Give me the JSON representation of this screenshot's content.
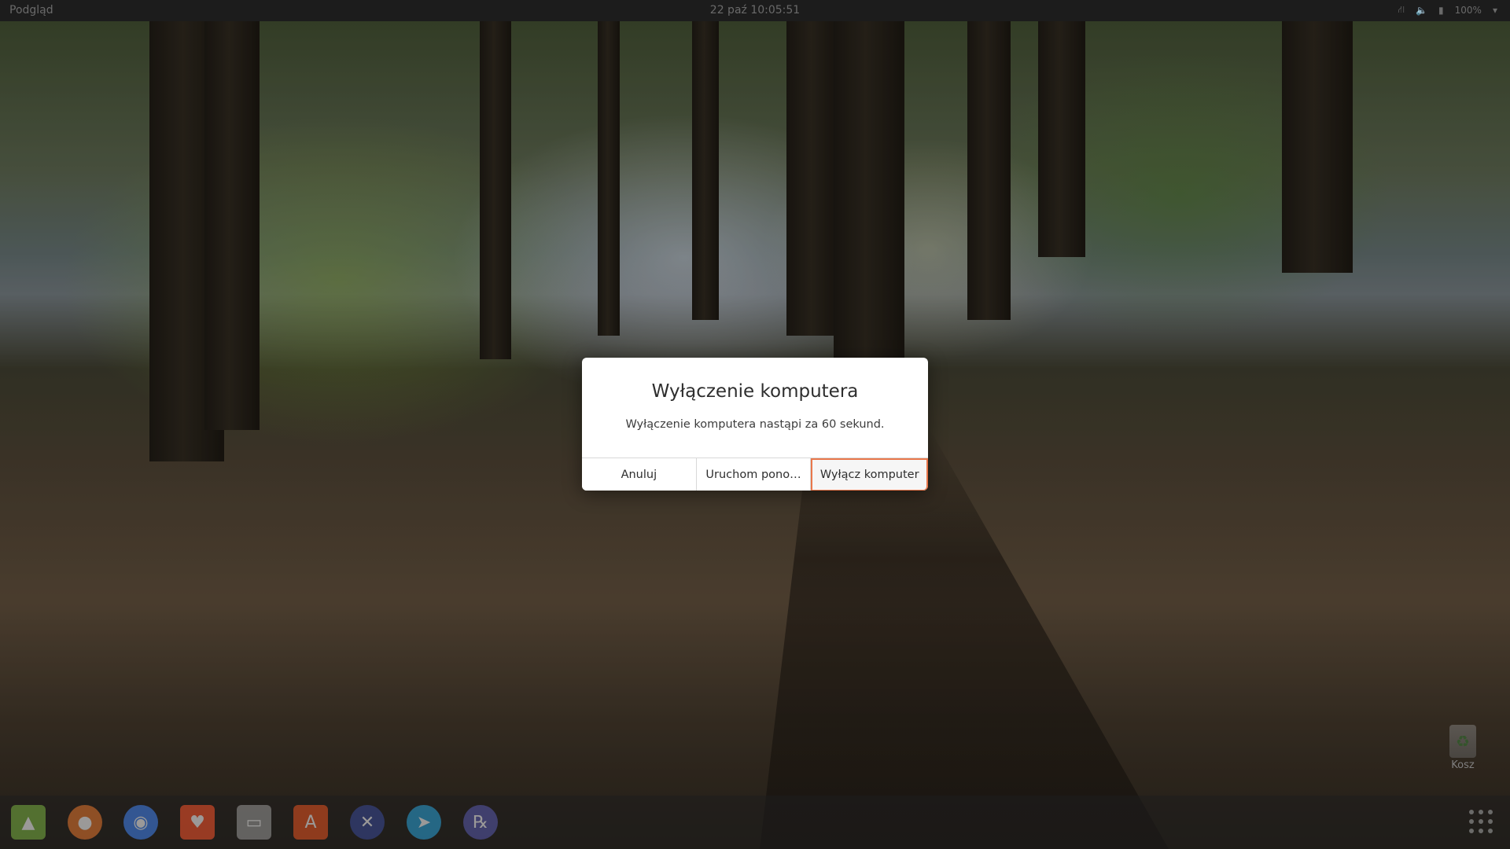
{
  "topbar": {
    "activities": "Podgląd",
    "clock": "22 paź  10:05:51",
    "battery": "100%"
  },
  "dialog": {
    "title": "Wyłączenie komputera",
    "message": "Wyłączenie komputera nastąpi za 60 sekund.",
    "buttons": {
      "cancel": "Anuluj",
      "restart": "Uruchom pono…",
      "shutdown": "Wyłącz komputer"
    },
    "focus_color": "#e9774b"
  },
  "desktop": {
    "trash_label": "Kosz"
  },
  "dock": {
    "items": [
      {
        "name": "android-studio-icon",
        "color": "#7cb342"
      },
      {
        "name": "firefox-icon",
        "color": "#e8772e"
      },
      {
        "name": "chrome-icon",
        "color": "#4285f4"
      },
      {
        "name": "brave-icon",
        "color": "#fb542b"
      },
      {
        "name": "files-icon",
        "color": "#9a9a9a"
      },
      {
        "name": "software-center-icon",
        "color": "#e95420"
      },
      {
        "name": "xcode-like-icon",
        "color": "#3a4a9a"
      },
      {
        "name": "telegram-icon",
        "color": "#2aa3db"
      },
      {
        "name": "rx-icon",
        "color": "#5a5ab0"
      }
    ]
  }
}
